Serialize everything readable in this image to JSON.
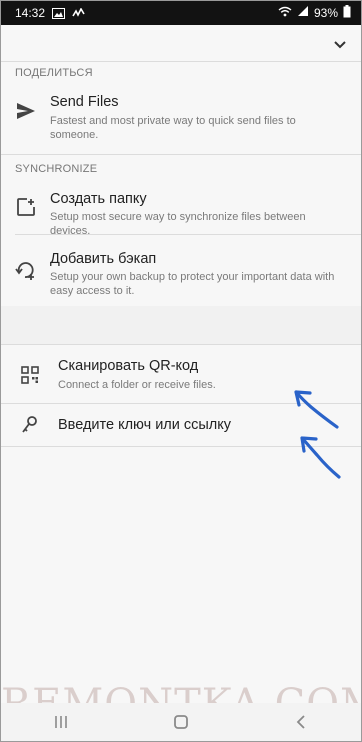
{
  "status_bar": {
    "time": "14:32",
    "battery": "93%",
    "icons": [
      "gallery-icon",
      "sync-activity-icon",
      "wifi-icon",
      "signal-icon",
      "battery-icon"
    ]
  },
  "share_section": {
    "header": "ПОДЕЛИТЬСЯ",
    "items": [
      {
        "title": "Send Files",
        "subtitle": "Fastest and most private way to quick send files to someone.",
        "icon": "send-icon"
      }
    ]
  },
  "sync_section": {
    "header": "SYNCHRONIZE",
    "items": [
      {
        "title": "Создать папку",
        "subtitle": "Setup most secure way to synchronize files between devices.",
        "icon": "add-folder-icon"
      },
      {
        "title": "Добавить бэкап",
        "subtitle": "Setup your own backup to protect your important data with easy access to it.",
        "icon": "backup-icon"
      }
    ]
  },
  "link_section": {
    "items": [
      {
        "title": "Сканировать QR-код",
        "subtitle": "Connect a folder or receive files.",
        "icon": "qr-code-icon"
      },
      {
        "title": "Введите ключ или ссылку",
        "icon": "key-icon"
      }
    ]
  },
  "watermark": "REMONTKA.COM",
  "colors": {
    "annotation_arrow": "#2a63c9",
    "status_bar": "#121212",
    "background": "#f7f7f7"
  }
}
